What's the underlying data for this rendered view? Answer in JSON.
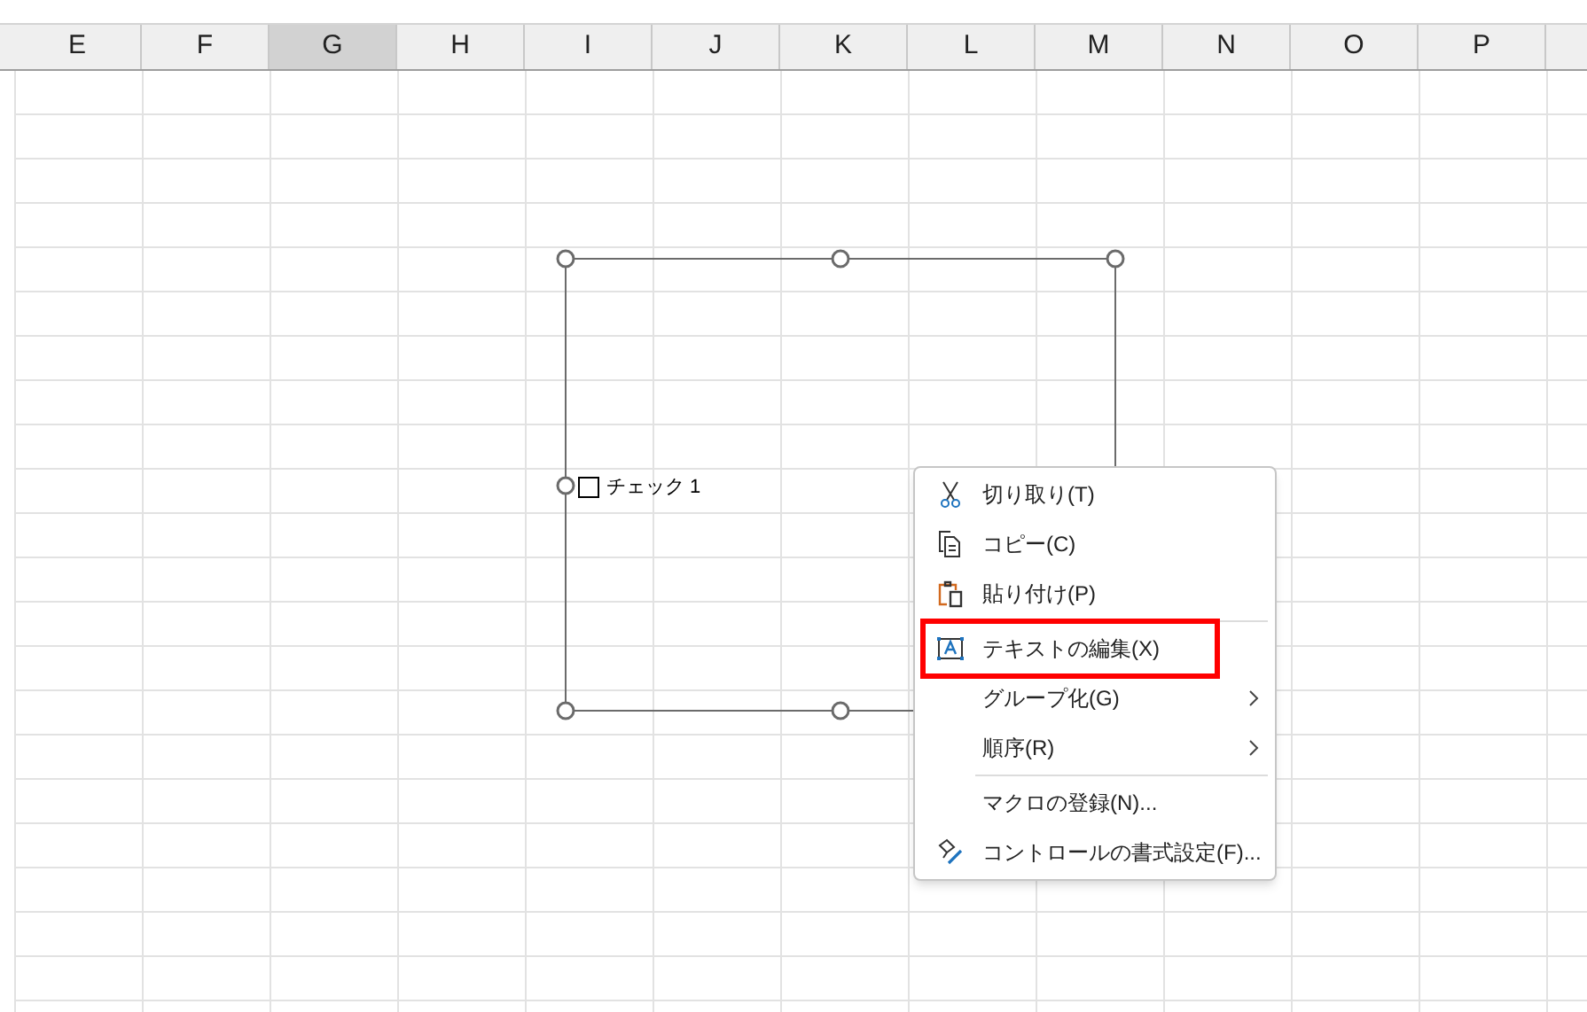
{
  "columns": [
    {
      "label": "E",
      "selected": false
    },
    {
      "label": "F",
      "selected": false
    },
    {
      "label": "G",
      "selected": true
    },
    {
      "label": "H",
      "selected": false
    },
    {
      "label": "I",
      "selected": false
    },
    {
      "label": "J",
      "selected": false
    },
    {
      "label": "K",
      "selected": false
    },
    {
      "label": "L",
      "selected": false
    },
    {
      "label": "M",
      "selected": false
    },
    {
      "label": "N",
      "selected": false
    },
    {
      "label": "O",
      "selected": false
    },
    {
      "label": "P",
      "selected": false
    }
  ],
  "checkbox": {
    "label": "チェック 1",
    "checked": false
  },
  "context_menu": {
    "groups": [
      [
        {
          "label": "切り取り(T)",
          "submenu": false,
          "highlighted": false
        },
        {
          "label": "コピー(C)",
          "submenu": false,
          "highlighted": false
        },
        {
          "label": "貼り付け(P)",
          "submenu": false,
          "highlighted": false
        }
      ],
      [
        {
          "label": "テキストの編集(X)",
          "submenu": false,
          "highlighted": true
        },
        {
          "label": "グループ化(G)",
          "submenu": true,
          "highlighted": false
        },
        {
          "label": "順序(R)",
          "submenu": true,
          "highlighted": false
        }
      ],
      [
        {
          "label": "マクロの登録(N)...",
          "submenu": false,
          "highlighted": false
        },
        {
          "label": "コントロールの書式設定(F)...",
          "submenu": false,
          "highlighted": false
        }
      ]
    ]
  }
}
